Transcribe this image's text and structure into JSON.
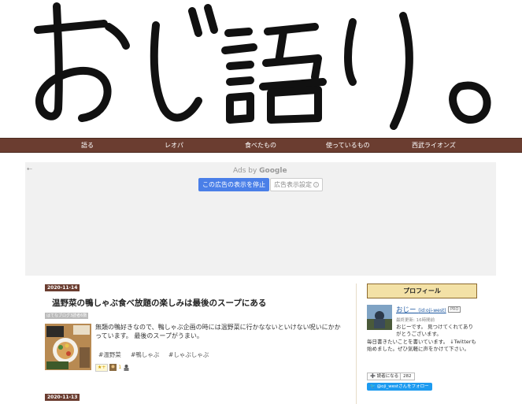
{
  "header": {
    "logo_text": "おじ語り。"
  },
  "nav": {
    "items": [
      {
        "label": "語る"
      },
      {
        "label": "レオパ"
      },
      {
        "label": "食べたもの"
      },
      {
        "label": "使っているもの"
      },
      {
        "label": "西武ライオンズ"
      }
    ]
  },
  "ad": {
    "back_glyph": "⇠",
    "ads_by_prefix": "Ads by ",
    "ads_by_brand": "Google",
    "stop_label": "この広告の表示を停止",
    "settings_label": "広告表示設定",
    "settings_icon_glyph": "i"
  },
  "article": {
    "date": "2020-11-14",
    "title": "温野菜の鴨しゃぶ食べ放題の楽しみは最後のスープにある",
    "read_count": "はてなブログ3読者6数",
    "excerpt": "無類の鴨好きなので、鴨しゃぶ企画の時には温野菜に行かなないといけない呪いにかかっています。 最後のスープがうまい。",
    "tags": [
      "#温野菜",
      "#鴨しゃぶ",
      "#しゃぶしゃぶ"
    ],
    "star_label": "★+",
    "star_count": "1"
  },
  "next_article": {
    "date": "2020-11-13"
  },
  "sidebar": {
    "profile_header": "プロフィール",
    "name": "おじー",
    "id": "(id:oji-west)",
    "pro_badge": "PRO",
    "last_updated": "最終更新: 16時間前",
    "bio_line_1": "おじーです。 見つけてくれてありがとうございます。",
    "bio_line_2": "毎日書きたいことを書いています。 ↓Twitterも始めました。ぜひ気軽に声をかけて下さい。",
    "reader_button": "➕ 読者になる",
    "reader_count": "282",
    "twitter_follow": "@oji_westさんをフォロー"
  },
  "colors": {
    "nav_bg": "#6b3d30",
    "profile_header_bg": "#f3e1a6",
    "ad_stop_bg": "#4a7fe8",
    "twitter_bg": "#1d9bf0"
  }
}
